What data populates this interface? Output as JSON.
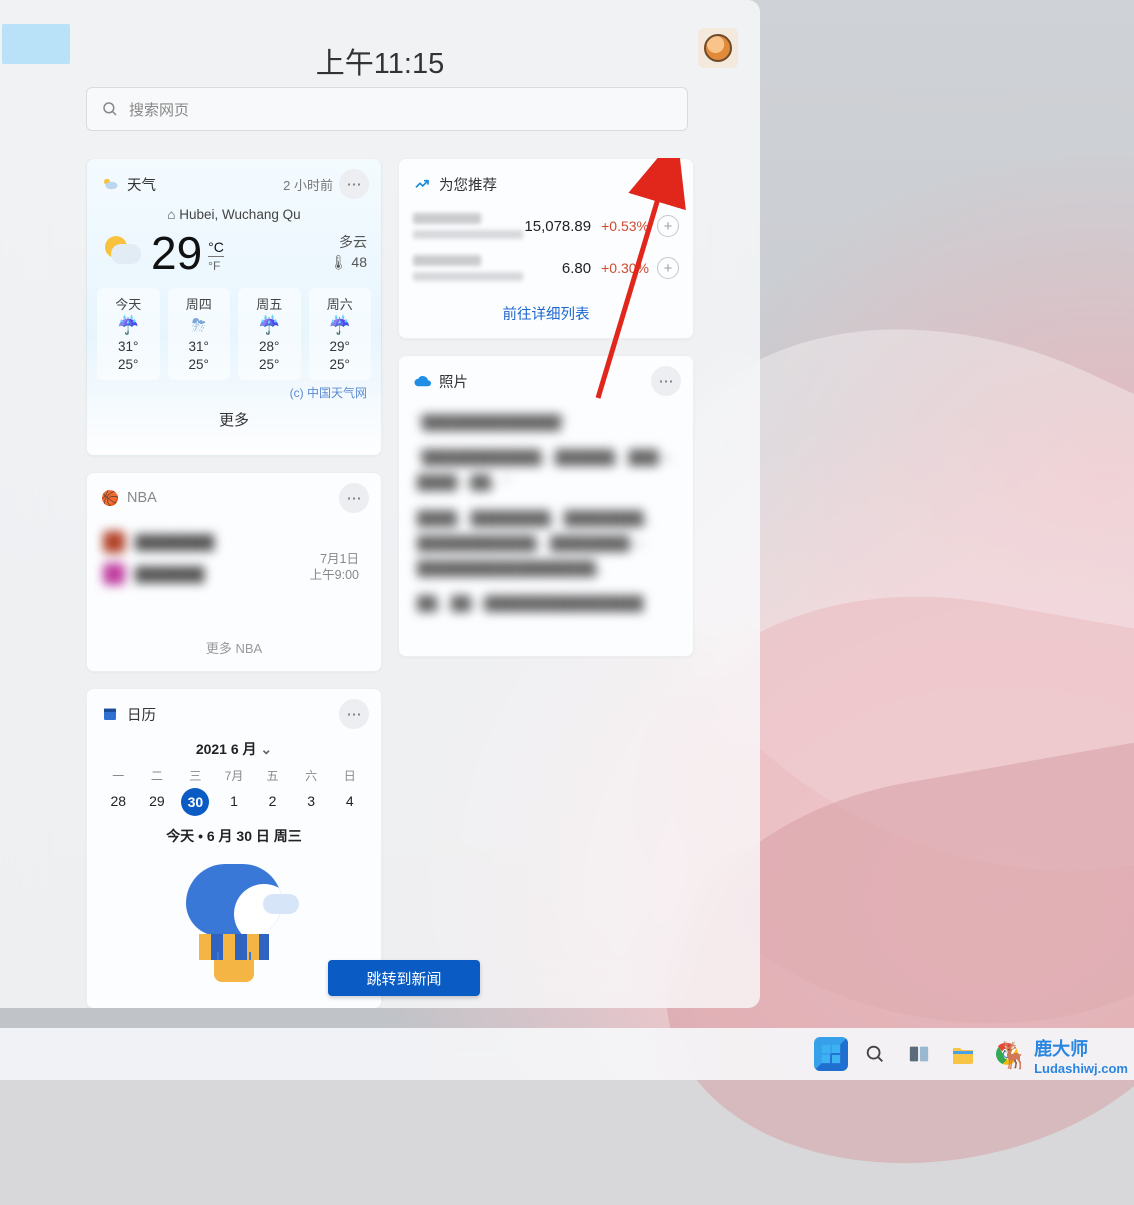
{
  "clock": "上午11:15",
  "search": {
    "placeholder": "搜索网页"
  },
  "weather": {
    "title": "天气",
    "updated": "2 小时前",
    "location": "Hubei, Wuchang Qu",
    "temp": "29",
    "unit_primary": "°C",
    "unit_secondary": "°F",
    "condition": "多云",
    "feels": "🌡 48",
    "forecast": [
      {
        "name": "今天",
        "hi": "31°",
        "lo": "25°"
      },
      {
        "name": "周四",
        "hi": "31°",
        "lo": "25°"
      },
      {
        "name": "周五",
        "hi": "28°",
        "lo": "25°"
      },
      {
        "name": "周六",
        "hi": "29°",
        "lo": "25°"
      }
    ],
    "attribution": "(c) 中国天气网",
    "more": "更多"
  },
  "recommend": {
    "title": "为您推荐",
    "rows": [
      {
        "value": "15,078.89",
        "change": "+0.53%"
      },
      {
        "value": "6.80",
        "change": "+0.30%"
      }
    ],
    "footer": "前往详细列表"
  },
  "photos": {
    "title": "照片"
  },
  "nba": {
    "title": "NBA",
    "date": "7月1日",
    "time": "上午9:00",
    "footer": "更多 NBA"
  },
  "calendar": {
    "title": "日历",
    "month": "2021 6 月",
    "dow": [
      "一",
      "二",
      "三",
      "7月",
      "五",
      "六",
      "日"
    ],
    "days": [
      "28",
      "29",
      "30",
      "1",
      "2",
      "3",
      "4"
    ],
    "selected_index": 2,
    "today_line": "今天 • 6 月 30 日 周三"
  },
  "jump_button": "跳转到新闻",
  "watermark": {
    "brand": "鹿大师",
    "url": "Ludashiwj.com"
  }
}
